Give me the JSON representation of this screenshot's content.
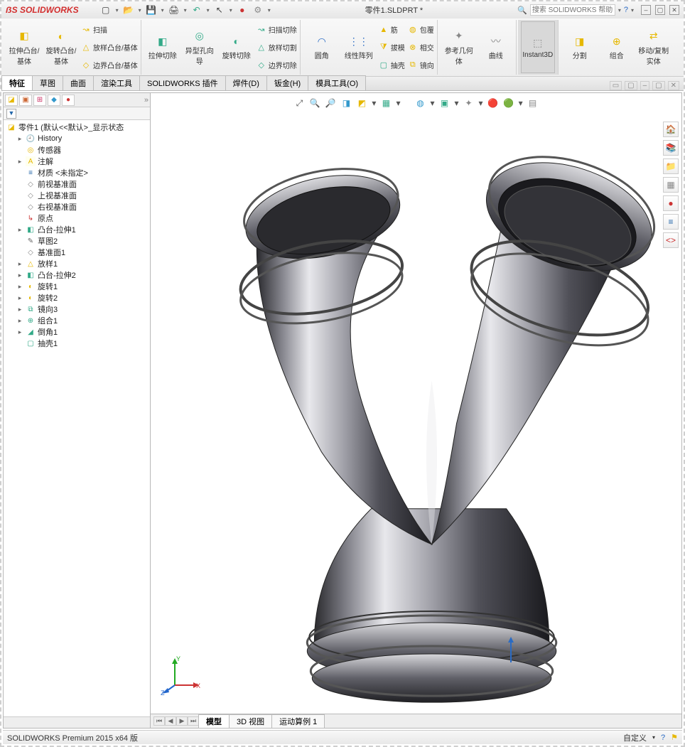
{
  "title_app": "SOLIDWORKS",
  "doc_name": "零件1.SLDPRT *",
  "search_placeholder": "搜索 SOLIDWORKS 帮助",
  "ribbon": {
    "g1_b1": "拉伸凸台/基体",
    "g1_b2": "旋转凸台/基体",
    "g1_c1": "扫描",
    "g1_c2": "放样凸台/基体",
    "g1_c3": "边界凸台/基体",
    "g2_b1": "拉伸切除",
    "g2_b2": "异型孔向导",
    "g2_b3": "旋转切除",
    "g2_c1": "扫描切除",
    "g2_c2": "放样切割",
    "g2_c3": "边界切除",
    "g3_b1": "圆角",
    "g3_b2": "线性阵列",
    "g3_c1": "筋",
    "g3_c2": "拔模",
    "g3_c3": "抽壳",
    "g3_d1": "包覆",
    "g3_d2": "相交",
    "g3_d3": "镜向",
    "g4_b1": "参考几何体",
    "g4_b2": "曲线",
    "g5_b1": "Instant3D",
    "g6_b1": "分割",
    "g6_b2": "组合",
    "g6_b3": "移动/复制实体"
  },
  "tabs": {
    "t1": "特征",
    "t2": "草图",
    "t3": "曲面",
    "t4": "渲染工具",
    "t5": "SOLIDWORKS 插件",
    "t6": "焊件(D)",
    "t7": "钣金(H)",
    "t8": "模具工具(O)"
  },
  "tree": {
    "root": "零件1  (默认<<默认>_显示状态",
    "history": "History",
    "sensors": "传感器",
    "annot": "注解",
    "material": "材质 <未指定>",
    "front": "前视基准面",
    "top": "上视基准面",
    "right": "右视基准面",
    "origin": "原点",
    "f1": "凸台-拉伸1",
    "f2": "草图2",
    "f3": "基准面1",
    "f4": "放样1",
    "f5": "凸台-拉伸2",
    "f6": "旋转1",
    "f7": "旋转2",
    "f8": "镜向3",
    "f9": "组合1",
    "f10": "倒角1",
    "f11": "抽壳1"
  },
  "bottom_tabs": {
    "b1": "模型",
    "b2": "3D 视图",
    "b3": "运动算例 1"
  },
  "status_left": "SOLIDWORKS Premium 2015 x64 版",
  "status_right": "自定义"
}
